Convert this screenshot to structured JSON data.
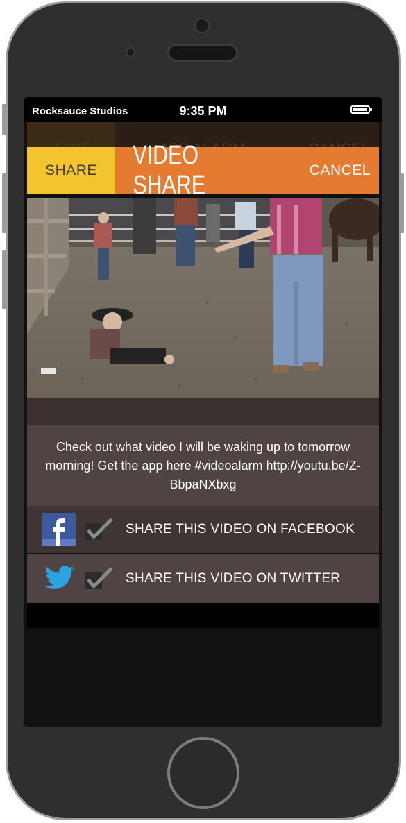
{
  "status_bar": {
    "carrier": "Rocksauce Studios",
    "time": "9:35 PM",
    "battery_icon": "battery-full-icon"
  },
  "behind_screen": {
    "left_label": "EDIT",
    "title": "APP ALARM",
    "right_label": "CANCEL"
  },
  "app_bar": {
    "share_label": "SHARE",
    "title": "VIDEO SHARE",
    "cancel_label": "CANCEL",
    "accent_color": "#e57b30",
    "share_color": "#f4c42f"
  },
  "video": {
    "thumbnail": "video-thumbnail-image"
  },
  "message": {
    "text": "Check out what video I will be waking up to tomorrow morning! Get the app here #videoalarm http://youtu.be/Z-BbpaNXbxg"
  },
  "share_options": [
    {
      "network": "facebook",
      "icon": "facebook-icon",
      "checked": true,
      "label": "SHARE THIS VIDEO ON FACEBOOK"
    },
    {
      "network": "twitter",
      "icon": "twitter-icon",
      "checked": true,
      "label": "SHARE THIS VIDEO ON TWITTER"
    }
  ]
}
